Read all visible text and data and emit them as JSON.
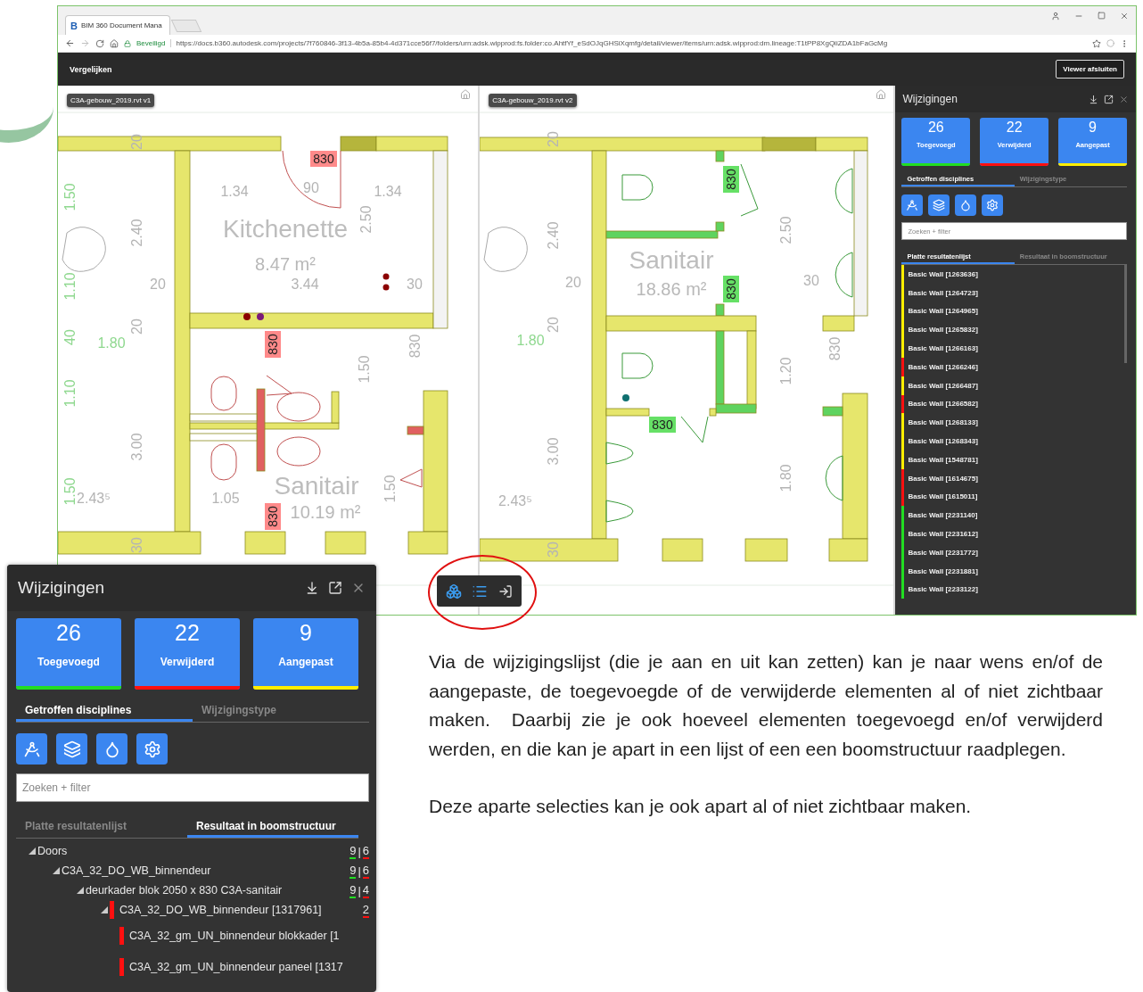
{
  "browser": {
    "tab_logo": "B",
    "tab_title": "BIM 360 Document Mana",
    "secure_label": "Beveiligd",
    "url": "https://docs.b360.autodesk.com/projects/7f760846-3f13-4b5a-85b4-4d371cce56f7/folders/urn:adsk.wipprod:fs.folder:co.AhtfYf_eSdOJqGHSiXqmfg/detail/viewer/items/urn:adsk.wipprod:dm.lineage:T1tPP8XgQiiZDA1bFaGcMg"
  },
  "app_bar": {
    "title": "Vergelijken",
    "close_button": "Viewer afsluiten"
  },
  "viewers": [
    {
      "label": "C3A-gebouw_2019.rvt v1",
      "labels": [
        {
          "kind": "dim",
          "text": "20"
        },
        {
          "kind": "tag",
          "text": "830",
          "color": "#ff8a8a"
        },
        {
          "kind": "dim",
          "text": "1.34"
        },
        {
          "kind": "dim",
          "text": "90"
        },
        {
          "kind": "dim",
          "text": "1.34"
        },
        {
          "kind": "guide",
          "text": "1.50"
        },
        {
          "kind": "dim",
          "text": "2.40"
        },
        {
          "kind": "room",
          "text": "Kitchenette"
        },
        {
          "kind": "dim",
          "text": "2.50"
        },
        {
          "kind": "area",
          "text": "8.47 m²"
        },
        {
          "kind": "guide",
          "text": "1.10"
        },
        {
          "kind": "dim",
          "text": "20"
        },
        {
          "kind": "dim",
          "text": "3.44"
        },
        {
          "kind": "dim",
          "text": "30"
        },
        {
          "kind": "guide",
          "text": "40"
        },
        {
          "kind": "guide",
          "text": "1.80"
        },
        {
          "kind": "dim",
          "text": "20"
        },
        {
          "kind": "tag",
          "text": "830",
          "color": "#ff8a8a"
        },
        {
          "kind": "dim",
          "text": "830"
        },
        {
          "kind": "dim",
          "text": "1.50"
        },
        {
          "kind": "guide",
          "text": "1.10"
        },
        {
          "kind": "dim",
          "text": "3.00"
        },
        {
          "kind": "guide",
          "text": "1.50"
        },
        {
          "kind": "dim",
          "text": "2.43⁵"
        },
        {
          "kind": "dim",
          "text": "1.05"
        },
        {
          "kind": "room",
          "text": "Sanitair"
        },
        {
          "kind": "dim",
          "text": "1.50"
        },
        {
          "kind": "area",
          "text": "10.19 m²"
        },
        {
          "kind": "tag",
          "text": "830",
          "color": "#ff8a8a"
        },
        {
          "kind": "dim",
          "text": "30"
        }
      ]
    },
    {
      "label": "C3A-gebouw_2019.rvt v2",
      "labels": [
        {
          "kind": "dim",
          "text": "20"
        },
        {
          "kind": "tag",
          "text": "830",
          "color": "#66e066"
        },
        {
          "kind": "dim",
          "text": "2.40"
        },
        {
          "kind": "room",
          "text": "Sanitair"
        },
        {
          "kind": "dim",
          "text": "2.50"
        },
        {
          "kind": "dim",
          "text": "20"
        },
        {
          "kind": "area",
          "text": "18.86 m²"
        },
        {
          "kind": "tag",
          "text": "830",
          "color": "#66e066"
        },
        {
          "kind": "dim",
          "text": "30"
        },
        {
          "kind": "guide",
          "text": "1.80"
        },
        {
          "kind": "dim",
          "text": "20"
        },
        {
          "kind": "dim",
          "text": "830"
        },
        {
          "kind": "dim",
          "text": "1.20"
        },
        {
          "kind": "tag",
          "text": "830",
          "color": "#66e066"
        },
        {
          "kind": "dim",
          "text": "3.00"
        },
        {
          "kind": "dim",
          "text": "1.80"
        },
        {
          "kind": "dim",
          "text": "2.43⁵"
        },
        {
          "kind": "dim",
          "text": "30"
        }
      ]
    }
  ],
  "changes_panel": {
    "title": "Wijzigingen",
    "summary": [
      {
        "count": "26",
        "label": "Toegevoegd",
        "color": "#22dd22"
      },
      {
        "count": "22",
        "label": "Verwijderd",
        "color": "#ff1010"
      },
      {
        "count": "9",
        "label": "Aangepast",
        "color": "#ffee00"
      }
    ],
    "discipline_tabs": [
      {
        "label": "Getroffen disciplines",
        "selected": true
      },
      {
        "label": "Wijzigingstype",
        "selected": false
      }
    ],
    "search": {
      "placeholder": "Zoeken + filter"
    },
    "result_tabs": [
      {
        "label": "Platte resultatenlijst",
        "selected": true
      },
      {
        "label": "Resultaat in boomstructuur",
        "selected": false
      }
    ],
    "items": [
      {
        "label": "Basic Wall [1263636]",
        "color": "#ffee00"
      },
      {
        "label": "Basic Wall [1264723]",
        "color": "#ffee00"
      },
      {
        "label": "Basic Wall [1264965]",
        "color": "#ffee00"
      },
      {
        "label": "Basic Wall [1265832]",
        "color": "#ffee00"
      },
      {
        "label": "Basic Wall [1266163]",
        "color": "#ffee00"
      },
      {
        "label": "Basic Wall [1266246]",
        "color": "#ff1010"
      },
      {
        "label": "Basic Wall [1266487]",
        "color": "#ffee00"
      },
      {
        "label": "Basic Wall [1266582]",
        "color": "#ff1010"
      },
      {
        "label": "Basic Wall [1268133]",
        "color": "#ffee00"
      },
      {
        "label": "Basic Wall [1268343]",
        "color": "#ffee00"
      },
      {
        "label": "Basic Wall [1548781]",
        "color": "#ffee00"
      },
      {
        "label": "Basic Wall [1614675]",
        "color": "#ff1010"
      },
      {
        "label": "Basic Wall [1615011]",
        "color": "#ff1010"
      },
      {
        "label": "Basic Wall [2231140]",
        "color": "#22dd22"
      },
      {
        "label": "Basic Wall [2231612]",
        "color": "#22dd22"
      },
      {
        "label": "Basic Wall [2231772]",
        "color": "#22dd22"
      },
      {
        "label": "Basic Wall [2231881]",
        "color": "#22dd22"
      },
      {
        "label": "Basic Wall [2233122]",
        "color": "#22dd22"
      }
    ]
  },
  "changes_panel_zoom": {
    "title": "Wijzigingen",
    "summary": [
      {
        "count": "26",
        "label": "Toegevoegd",
        "color": "#22dd22"
      },
      {
        "count": "22",
        "label": "Verwijderd",
        "color": "#ff1010"
      },
      {
        "count": "9",
        "label": "Aangepast",
        "color": "#ffee00"
      }
    ],
    "discipline_tabs": [
      {
        "label": "Getroffen disciplines",
        "selected": true
      },
      {
        "label": "Wijzigingstype",
        "selected": false
      }
    ],
    "search": {
      "placeholder": "Zoeken + filter"
    },
    "result_tabs": [
      {
        "label": "Platte resultatenlijst",
        "selected": false
      },
      {
        "label": "Resultaat in boomstructuur",
        "selected": true
      }
    ],
    "count_separator": "|",
    "tree": [
      {
        "label": "Doors",
        "added": "9",
        "removed": "6",
        "children": [
          {
            "label": "C3A_32_DO_WB_binnendeur",
            "added": "9",
            "removed": "6",
            "children": [
              {
                "label": "deurkader blok 2050 x 830 C3A-sanitair",
                "added": "9",
                "removed": "4",
                "children": [
                  {
                    "label": "C3A_32_DO_WB_binnendeur [1317961]",
                    "color": "#ff1010",
                    "removed": "2",
                    "children": [
                      {
                        "label": "C3A_32_gm_UN_binnendeur blokkader [1",
                        "color": "#ff1010"
                      },
                      {
                        "label": "C3A_32_gm_UN_binnendeur paneel [1317",
                        "color": "#ff1010"
                      }
                    ]
                  }
                ]
              }
            ]
          }
        ]
      }
    ]
  },
  "paragraphs": [
    "Via de wijzigingslijst (die je aan en uit kan zetten) kan je naar wens en/of de aangepaste, de toegevoegde of de verwijderde elementen al of niet zichtbaar maken.  Daarbij zie je ook hoeveel elementen toegevoegd en/of verwijderd werden, en die kan je apart in een lijst of een een boomstructuur raadplegen.",
    "Deze aparte selecties kan je ook apart al of niet zichtbaar maken."
  ]
}
